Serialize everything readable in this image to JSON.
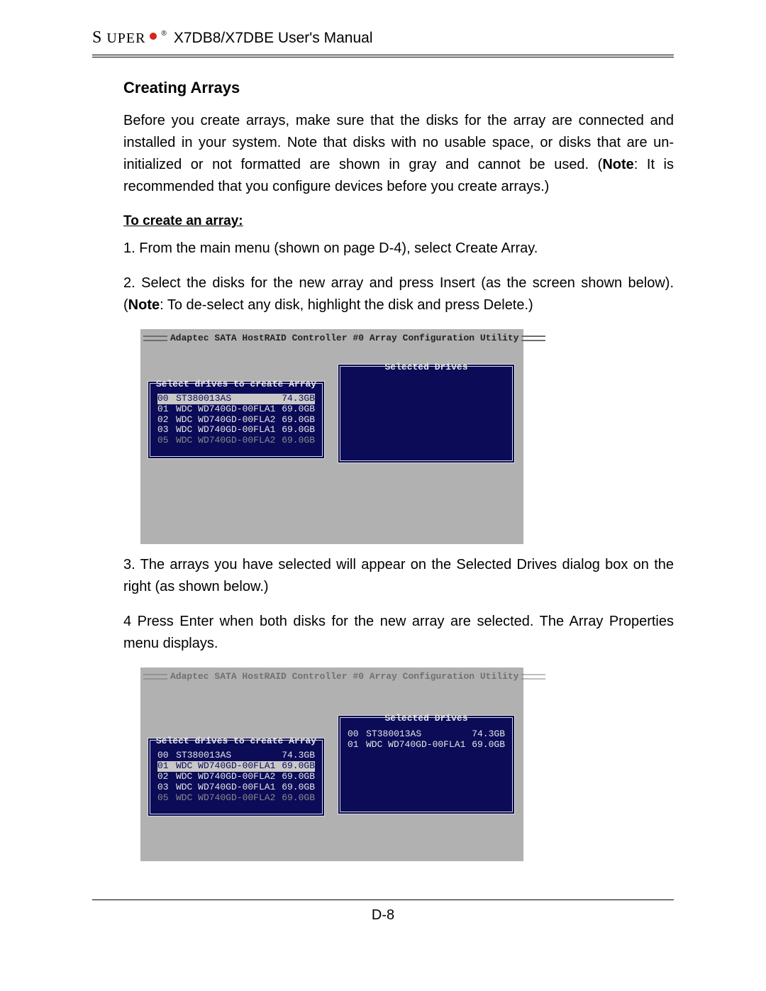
{
  "header": {
    "brand_first": "S",
    "brand_rest": "UPER",
    "reg": "®",
    "title": "X7DB8/X7DBE User's Manual"
  },
  "section": {
    "title": "Creating Arrays",
    "intro_a": "Before you create arrays, make sure that the disks for the array are connected and installed in your system. Note that disks with no usable space, or disks that are un-initialized or not formatted are shown in gray and cannot be used. (",
    "intro_note": "Note",
    "intro_b": ": It is recommended that you configure devices before you create arrays.)",
    "subhead": "To create an array:",
    "step1": "1. From the main menu (shown on page D-4), select Create Array.",
    "step2_a": "2. Select the disks for the new array and press Insert (as the screen shown below). (",
    "step2_note": "Note",
    "step2_b": ": To de-select any disk, highlight the disk and press Delete.)",
    "step3": "3. The arrays you have selected will appear on the Selected Drives dialog box on the right (as shown below.)",
    "step4": "4 Press Enter when both disks for the new array are selected. The Array Properties menu displays."
  },
  "fig1": {
    "title": "Adaptec SATA HostRAID Controller #0 Array Configuration Utility",
    "left_label": "Select drives to create Array",
    "right_label": "Selected Drives",
    "drives": [
      {
        "id": "00",
        "model": "ST380013AS",
        "size": "74.3GB",
        "style": "sel"
      },
      {
        "id": "01",
        "model": "WDC WD740GD-00FLA1",
        "size": "69.0GB",
        "style": ""
      },
      {
        "id": "02",
        "model": "WDC WD740GD-00FLA2",
        "size": "69.0GB",
        "style": ""
      },
      {
        "id": "03",
        "model": "WDC WD740GD-00FLA1",
        "size": "69.0GB",
        "style": ""
      },
      {
        "id": "05",
        "model": "WDC WD740GD-00FLA2",
        "size": "69.0GB",
        "style": "dim"
      }
    ]
  },
  "fig2": {
    "title": "Adaptec SATA HostRAID Controller #0 Array Configuration Utility",
    "left_label": "Select drives to create Array",
    "right_label": "Selected Drives",
    "drives": [
      {
        "id": "00",
        "model": "ST380013AS",
        "size": "74.3GB",
        "style": ""
      },
      {
        "id": "01",
        "model": "WDC WD740GD-00FLA1",
        "size": "69.0GB",
        "style": "sel"
      },
      {
        "id": "02",
        "model": "WDC WD740GD-00FLA2",
        "size": "69.0GB",
        "style": ""
      },
      {
        "id": "03",
        "model": "WDC WD740GD-00FLA1",
        "size": "69.0GB",
        "style": ""
      },
      {
        "id": "05",
        "model": "WDC WD740GD-00FLA2",
        "size": "69.0GB",
        "style": "dim"
      }
    ],
    "selected": [
      {
        "id": "00",
        "model": "ST380013AS",
        "size": "74.3GB"
      },
      {
        "id": "01",
        "model": "WDC WD740GD-00FLA1",
        "size": "69.0GB"
      }
    ]
  },
  "footer": {
    "page": "D-8"
  }
}
